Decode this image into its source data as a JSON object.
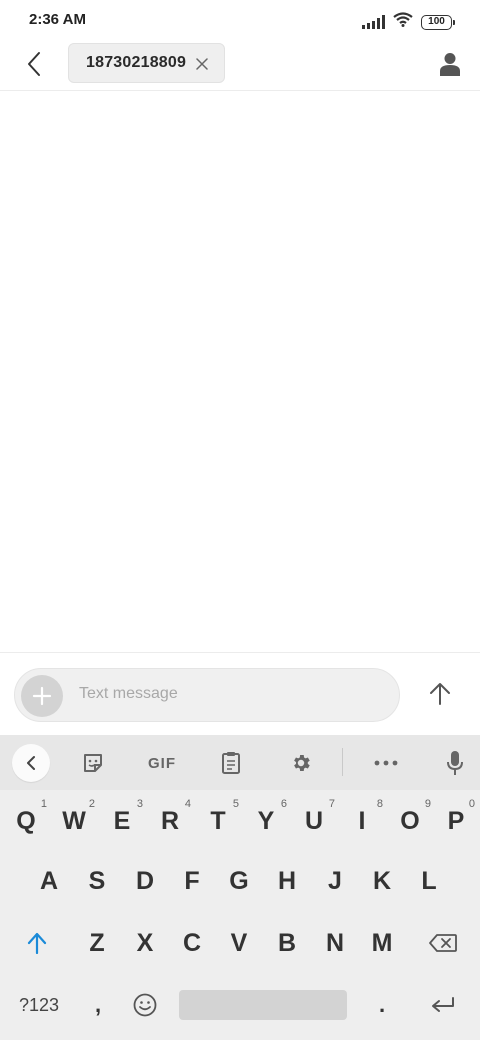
{
  "status_bar": {
    "time": "2:36 AM",
    "battery": "100"
  },
  "header": {
    "recipient": "18730218809"
  },
  "compose": {
    "placeholder": "Text message"
  },
  "keyboard": {
    "toolbar": {
      "gif_label": "GIF"
    },
    "row1": [
      {
        "key": "Q",
        "sub": "1"
      },
      {
        "key": "W",
        "sub": "2"
      },
      {
        "key": "E",
        "sub": "3"
      },
      {
        "key": "R",
        "sub": "4"
      },
      {
        "key": "T",
        "sub": "5"
      },
      {
        "key": "Y",
        "sub": "6"
      },
      {
        "key": "U",
        "sub": "7"
      },
      {
        "key": "I",
        "sub": "8"
      },
      {
        "key": "O",
        "sub": "9"
      },
      {
        "key": "P",
        "sub": "0"
      }
    ],
    "row2": [
      "A",
      "S",
      "D",
      "F",
      "G",
      "H",
      "J",
      "K",
      "L"
    ],
    "row3": [
      "Z",
      "X",
      "C",
      "V",
      "B",
      "N",
      "M"
    ],
    "symbols_label": "?123",
    "comma": ",",
    "period": "."
  },
  "colors": {
    "accent": "#1a8ad8",
    "keyboard_bg": "#eeeeee",
    "toolbar_bg": "#e7e7e7"
  }
}
